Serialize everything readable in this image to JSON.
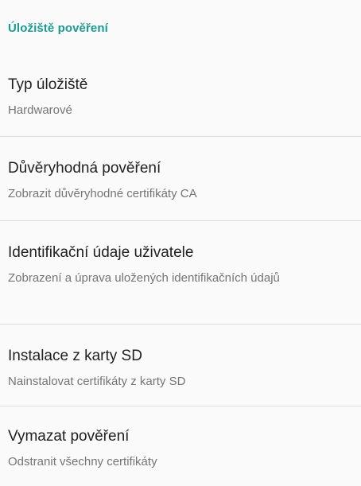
{
  "section": {
    "title": "Úložiště pověření"
  },
  "items": [
    {
      "title": "Typ úložiště",
      "summary": "Hardwarové"
    },
    {
      "title": "Důvěryhodná pověření",
      "summary": "Zobrazit důvěryhodné certifikáty CA"
    },
    {
      "title": "Identifikační údaje uživatele",
      "summary": "Zobrazení a úprava uložených identifikačních údajů"
    },
    {
      "title": "Instalace z karty SD",
      "summary": "Nainstalovat certifikáty z karty SD"
    },
    {
      "title": "Vymazat pověření",
      "summary": "Odstranit všechny certifikáty"
    }
  ],
  "colors": {
    "accent": "#1a9c8e",
    "title": "#212121",
    "summary": "#757575",
    "divider": "#dcdcdc",
    "background": "#fafafa"
  }
}
